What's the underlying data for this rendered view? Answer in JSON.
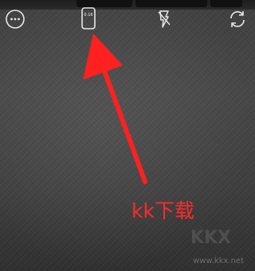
{
  "top_bar": {
    "more_icon": "more-horizontal-icon",
    "shutter_icon": "shutter-speed-icon",
    "shutter_value": "0.16",
    "flash_icon": "flash-off-icon",
    "switch_icon": "switch-camera-icon"
  },
  "annotation": {
    "caption": "kk下载",
    "color": "#ff2a2a"
  },
  "watermark": {
    "text": "www.kkx.net",
    "logo": "KKX"
  }
}
